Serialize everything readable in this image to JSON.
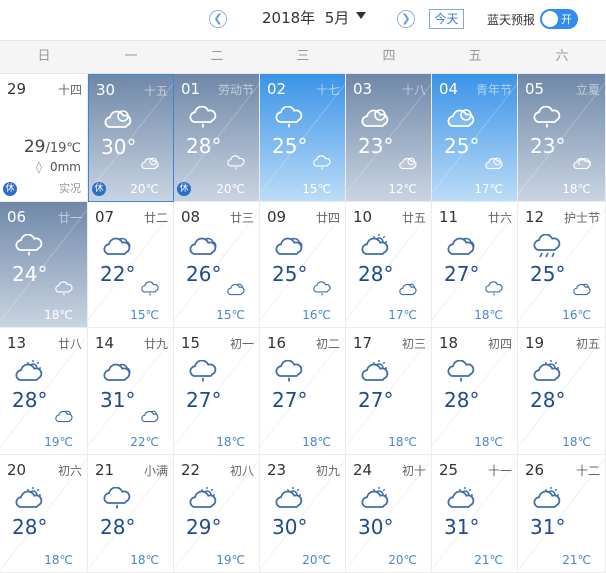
{
  "header": {
    "prev_icon": "chevron-left-icon",
    "next_icon": "chevron-right-icon",
    "prev_glyph": "❮",
    "next_glyph": "❯",
    "year_month": "2018年  5月",
    "today_label": "今天",
    "forecast_label": "蓝天预报",
    "toggle_label": "开",
    "toggle_on": true
  },
  "weekdays": [
    "日",
    "一",
    "二",
    "三",
    "四",
    "五",
    "六"
  ],
  "colors": {
    "accent": "#2f8cf0",
    "temp_text": "#1f4d8a",
    "low_temp_text": "#4a86c8",
    "past_gray_top": "#6f88a8",
    "forecast_blue_top": "#3a93e8"
  },
  "past_day": {
    "day": "29",
    "lunar": "十四",
    "temp_high": "29",
    "temp_low": "/19℃",
    "rain": "0mm",
    "rain_icon": "raindrop-icon",
    "note": "实况",
    "holiday": "休"
  },
  "days": [
    {
      "day": "30",
      "lunar": "十五",
      "style": "gray",
      "today": true,
      "icon": "partly-cloudy-icon",
      "temp": "30°",
      "low_icon": "partly-cloudy-icon",
      "low": "20℃",
      "holiday": "休"
    },
    {
      "day": "01",
      "lunar": "劳动节",
      "style": "gray",
      "icon": "rain-icon",
      "temp": "28°",
      "low_icon": "rain-icon",
      "low": "20℃",
      "holiday": "休"
    },
    {
      "day": "02",
      "lunar": "十七",
      "style": "blue",
      "icon": "rain-icon",
      "temp": "25°",
      "low_icon": "rain-icon",
      "low": "15℃"
    },
    {
      "day": "03",
      "lunar": "十八",
      "style": "gray",
      "icon": "partly-cloudy-icon",
      "temp": "23°",
      "low_icon": "partly-cloudy-icon",
      "low": "12℃"
    },
    {
      "day": "04",
      "lunar": "青年节",
      "style": "blue",
      "icon": "partly-cloudy-icon",
      "temp": "25°",
      "low_icon": "partly-cloudy-icon",
      "low": "17℃"
    },
    {
      "day": "05",
      "lunar": "立夏",
      "style": "gray",
      "icon": "rain-icon",
      "temp": "23°",
      "low_icon": "cloudy-icon",
      "low": "18℃"
    },
    {
      "day": "06",
      "lunar": "廿一",
      "style": "gray",
      "icon": "rain-icon",
      "temp": "24°",
      "low_icon": "rain-icon",
      "low": "18℃"
    },
    {
      "day": "07",
      "lunar": "廿二",
      "icon": "cloudy-icon",
      "temp": "22°",
      "low_icon": "rain-icon",
      "low": "15℃"
    },
    {
      "day": "08",
      "lunar": "廿三",
      "icon": "cloudy-icon",
      "temp": "26°",
      "low_icon": "partly-cloudy-icon",
      "low": "15℃"
    },
    {
      "day": "09",
      "lunar": "廿四",
      "icon": "cloudy-icon",
      "temp": "25°",
      "low_icon": "rain-icon",
      "low": "16℃"
    },
    {
      "day": "10",
      "lunar": "廿五",
      "icon": "sun-cloud-icon",
      "temp": "28°",
      "low_icon": "partly-cloudy-icon",
      "low": "17℃"
    },
    {
      "day": "11",
      "lunar": "廿六",
      "icon": "cloudy-icon",
      "temp": "27°",
      "low_icon": "rain-icon",
      "low": "18℃"
    },
    {
      "day": "12",
      "lunar": "护士节",
      "icon": "thunder-rain-icon",
      "temp": "25°",
      "low_icon": "partly-cloudy-icon",
      "low": "16℃"
    },
    {
      "day": "13",
      "lunar": "廿八",
      "icon": "sun-cloud-icon",
      "temp": "28°",
      "low_icon": "partly-cloudy-icon",
      "low": "19℃"
    },
    {
      "day": "14",
      "lunar": "廿九",
      "icon": "cloudy-icon",
      "temp": "31°",
      "low_icon": "partly-cloudy-icon",
      "low": "22℃"
    },
    {
      "day": "15",
      "lunar": "初一",
      "icon": "rain-icon",
      "temp": "27°",
      "low": "18℃"
    },
    {
      "day": "16",
      "lunar": "初二",
      "icon": "rain-icon",
      "temp": "27°",
      "low": "18℃"
    },
    {
      "day": "17",
      "lunar": "初三",
      "icon": "sun-cloud-icon",
      "temp": "27°",
      "low": "18℃"
    },
    {
      "day": "18",
      "lunar": "初四",
      "icon": "rain-icon",
      "temp": "28°",
      "low": "18℃"
    },
    {
      "day": "19",
      "lunar": "初五",
      "icon": "sun-cloud-icon",
      "temp": "28°",
      "low": "18℃"
    },
    {
      "day": "20",
      "lunar": "初六",
      "icon": "sun-cloud-icon",
      "temp": "28°",
      "low": "18℃"
    },
    {
      "day": "21",
      "lunar": "小满",
      "icon": "rain-icon",
      "temp": "28°",
      "low": "18℃"
    },
    {
      "day": "22",
      "lunar": "初八",
      "icon": "sun-cloud-icon",
      "temp": "29°",
      "low": "19℃"
    },
    {
      "day": "23",
      "lunar": "初九",
      "icon": "sun-cloud-icon",
      "temp": "30°",
      "low": "20℃"
    },
    {
      "day": "24",
      "lunar": "初十",
      "icon": "sun-cloud-icon",
      "temp": "30°",
      "low": "20℃"
    },
    {
      "day": "25",
      "lunar": "十一",
      "icon": "sun-cloud-icon",
      "temp": "31°",
      "low": "21℃"
    },
    {
      "day": "26",
      "lunar": "十二",
      "icon": "sun-cloud-icon",
      "temp": "31°",
      "low": "21℃"
    }
  ]
}
